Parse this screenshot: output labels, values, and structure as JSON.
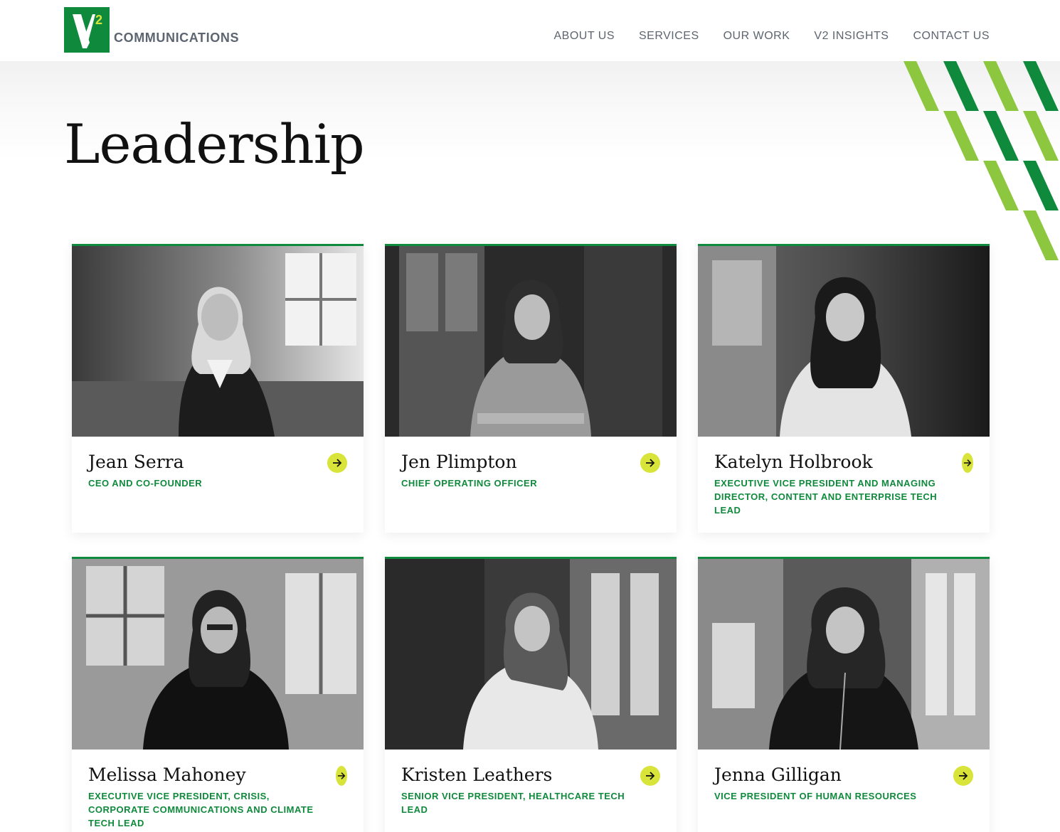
{
  "brand": {
    "logo_superscript": "2",
    "logo_text": "COMMUNICATIONS",
    "colors": {
      "green": "#0f8a3c",
      "lime": "#8dc63f",
      "accent_yellow": "#d9e43a",
      "nav_gray": "#5c6570"
    }
  },
  "nav": {
    "items": [
      "ABOUT US",
      "SERVICES",
      "OUR WORK",
      "V2 INSIGHTS",
      "CONTACT US"
    ]
  },
  "page": {
    "title": "Leadership"
  },
  "leaders": [
    {
      "name": "Jean Serra",
      "role": "CEO AND CO-FOUNDER",
      "icon": "arrow-right-icon"
    },
    {
      "name": "Jen Plimpton",
      "role": "CHIEF OPERATING OFFICER",
      "icon": "arrow-right-icon"
    },
    {
      "name": "Katelyn Holbrook",
      "role": "EXECUTIVE VICE PRESIDENT AND MANAGING DIRECTOR, CONTENT AND ENTERPRISE TECH LEAD",
      "icon": "arrow-right-icon"
    },
    {
      "name": "Melissa Mahoney",
      "role": "EXECUTIVE VICE PRESIDENT, CRISIS, CORPORATE COMMUNICATIONS AND CLIMATE TECH LEAD",
      "icon": "arrow-right-icon"
    },
    {
      "name": "Kristen Leathers",
      "role": "SENIOR VICE PRESIDENT, HEALTHCARE TECH LEAD",
      "icon": "arrow-right-icon"
    },
    {
      "name": "Jenna Gilligan",
      "role": "VICE PRESIDENT OF HUMAN RESOURCES",
      "icon": "arrow-right-icon"
    }
  ]
}
